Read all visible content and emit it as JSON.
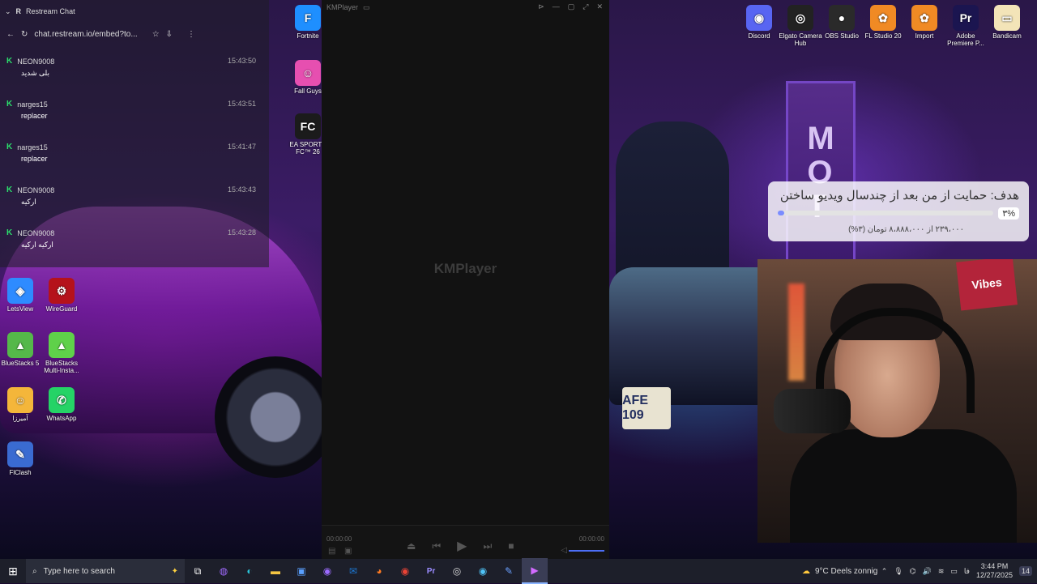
{
  "browser": {
    "tab_title": "Restream Chat",
    "url": "chat.restream.io/embed?to...",
    "messages": [
      {
        "user": "NEON9008",
        "time": "15:43:50",
        "text": "بلی شدید"
      },
      {
        "user": "narges15",
        "time": "15:43:51",
        "text": "replacer"
      },
      {
        "user": "narges15",
        "time": "15:41:47",
        "text": "replacer"
      },
      {
        "user": "NEON9008",
        "time": "15:43:43",
        "text": "ارکیه"
      },
      {
        "user": "NEON9008",
        "time": "15:43:28",
        "text": "ارکیه ارکیه"
      }
    ]
  },
  "desktop_left": [
    {
      "label": "LetsView",
      "glyph": "◈",
      "color": "#2e8bff"
    },
    {
      "label": "WireGuard",
      "glyph": "⚙",
      "color": "#b5121b"
    },
    {
      "label": "BlueStacks 5",
      "glyph": "▲",
      "color": "#55b84a"
    },
    {
      "label": "BlueStacks Multi-Insta...",
      "glyph": "▲",
      "color": "#5fd14a"
    },
    {
      "label": "آمیرزا",
      "glyph": "☺",
      "color": "#f4b63a"
    },
    {
      "label": "WhatsApp",
      "glyph": "✆",
      "color": "#25d366"
    },
    {
      "label": "FlClash",
      "glyph": "✎",
      "color": "#3a6bd1"
    }
  ],
  "desktop_mid": [
    {
      "label": "Fortnite",
      "glyph": "F",
      "color": "#1e8fff"
    },
    {
      "label": "Fall Guys",
      "glyph": "☺",
      "color": "#e64fb0"
    },
    {
      "label": "EA SPORTS FC™ 26",
      "glyph": "FC",
      "color": "#1b1b1b"
    }
  ],
  "desktop_right": [
    {
      "label": "Discord",
      "glyph": "◉",
      "color": "#5865f2"
    },
    {
      "label": "Elgato Camera Hub",
      "glyph": "◎",
      "color": "#222"
    },
    {
      "label": "OBS Studio",
      "glyph": "●",
      "color": "#2a2a2a"
    },
    {
      "label": "FL Studio 20",
      "glyph": "✿",
      "color": "#f08a24"
    },
    {
      "label": "Import",
      "glyph": "✿",
      "color": "#f08a24"
    },
    {
      "label": "Adobe Premiere P...",
      "glyph": "Pr",
      "color": "#1b1550"
    },
    {
      "label": "Bandicam",
      "glyph": "▭",
      "color": "#f3e4b8"
    }
  ],
  "kmplayer": {
    "title": "KMPlayer",
    "logo": "KMPlayer",
    "time_start": "00:00:00",
    "time_end": "00:00:00"
  },
  "goal": {
    "title": "هدف: حمایت از من بعد از چندسال ویدیو ساختن",
    "percent": "۳%",
    "amount": "۲۳۹،۰۰۰ از ۸،۸۸۸،۰۰۰ تومان (۳%)",
    "progress": 0.03
  },
  "webcam": {
    "sign": "Vibes"
  },
  "taskbar": {
    "search_placeholder": "Type here to search",
    "weather": "9°C  Deels zonnig",
    "time": "3:44 PM",
    "date": "12/27/2025",
    "notifications": "14"
  }
}
